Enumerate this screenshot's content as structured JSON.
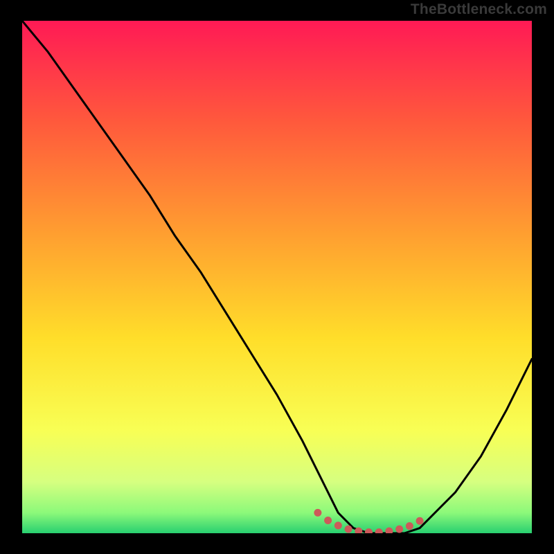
{
  "watermark": "TheBottleneck.com",
  "chart_data": {
    "type": "line",
    "title": "",
    "xlabel": "",
    "ylabel": "",
    "xlim": [
      0,
      100
    ],
    "ylim": [
      0,
      100
    ],
    "x": [
      0,
      5,
      10,
      15,
      20,
      25,
      30,
      35,
      40,
      45,
      50,
      55,
      58,
      60,
      62,
      65,
      68,
      70,
      72,
      75,
      78,
      80,
      85,
      90,
      95,
      100
    ],
    "values": [
      100,
      94,
      87,
      80,
      73,
      66,
      58,
      51,
      43,
      35,
      27,
      18,
      12,
      8,
      4,
      1,
      0,
      0,
      0,
      0,
      1,
      3,
      8,
      15,
      24,
      34
    ],
    "markers": {
      "x": [
        58,
        60,
        62,
        64,
        66,
        68,
        70,
        72,
        74,
        76,
        78
      ],
      "y": [
        4,
        2.5,
        1.5,
        0.8,
        0.4,
        0.2,
        0.2,
        0.4,
        0.8,
        1.4,
        2.4
      ],
      "color": "#cc5a5a",
      "radius": 5.5
    },
    "gradient_stops": [
      {
        "offset": 0.0,
        "color": "#ff1a55"
      },
      {
        "offset": 0.2,
        "color": "#ff5a3c"
      },
      {
        "offset": 0.42,
        "color": "#ffa030"
      },
      {
        "offset": 0.62,
        "color": "#ffde2a"
      },
      {
        "offset": 0.8,
        "color": "#f8ff55"
      },
      {
        "offset": 0.9,
        "color": "#d6ff80"
      },
      {
        "offset": 0.96,
        "color": "#8cf97a"
      },
      {
        "offset": 1.0,
        "color": "#28d070"
      }
    ],
    "line_color": "#000000",
    "line_width": 3
  }
}
